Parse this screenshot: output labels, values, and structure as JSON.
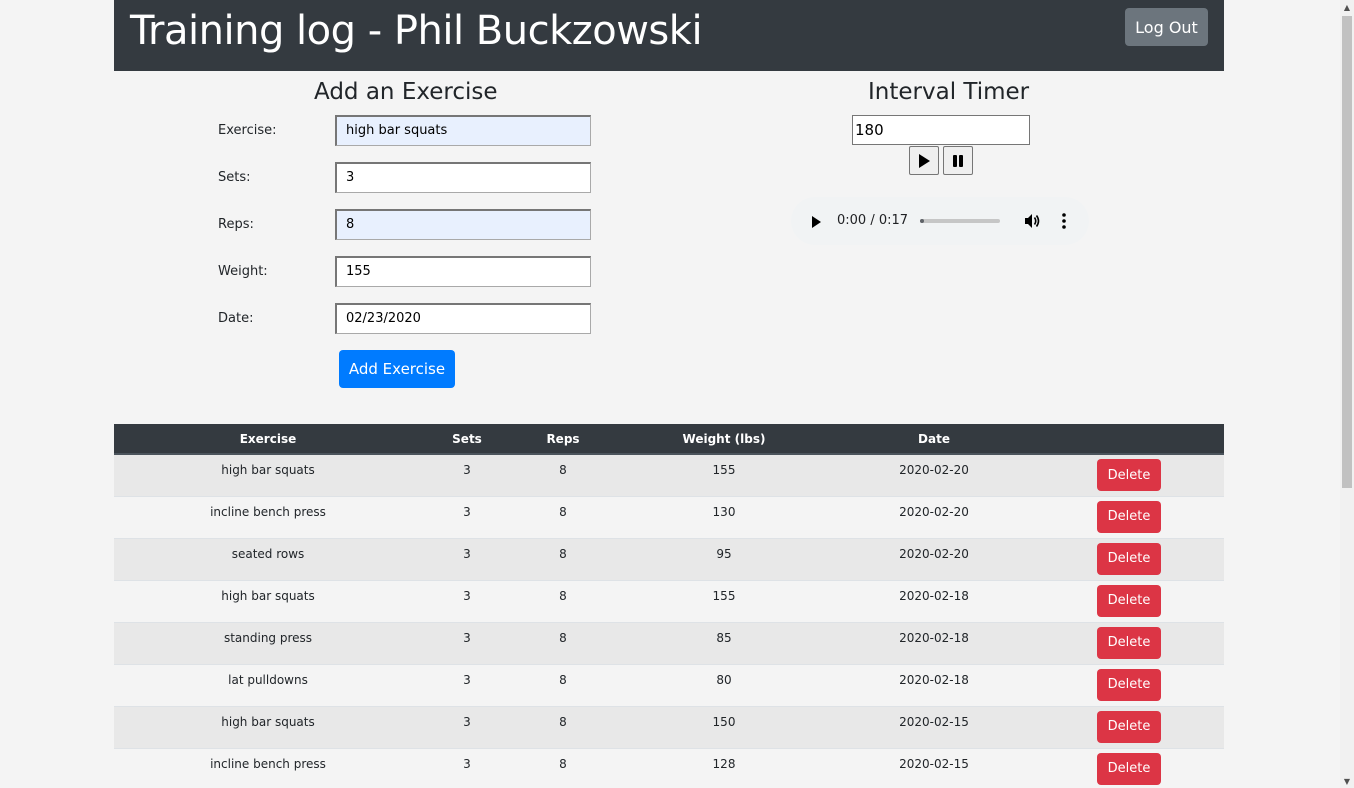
{
  "header": {
    "title": "Training log - Phil Buckzowski",
    "logout_label": "Log Out"
  },
  "add_exercise": {
    "title": "Add an Exercise",
    "fields": {
      "exercise": {
        "label": "Exercise:",
        "value": "high bar squats"
      },
      "sets": {
        "label": "Sets:",
        "value": "3"
      },
      "reps": {
        "label": "Reps:",
        "value": "8"
      },
      "weight": {
        "label": "Weight:",
        "value": "155"
      },
      "date": {
        "label": "Date:",
        "value": "02/23/2020"
      }
    },
    "submit_label": "Add Exercise"
  },
  "timer": {
    "title": "Interval Timer",
    "seconds": "180",
    "play_icon": "play-icon",
    "pause_icon": "pause-icon",
    "audio": {
      "time": "0:00 / 0:17",
      "progress": 0.05
    }
  },
  "table": {
    "headers": [
      "Exercise",
      "Sets",
      "Reps",
      "Weight (lbs)",
      "Date",
      ""
    ],
    "delete_label": "Delete",
    "rows": [
      {
        "exercise": "high bar squats",
        "sets": "3",
        "reps": "8",
        "weight": "155",
        "date": "2020-02-20"
      },
      {
        "exercise": "incline bench press",
        "sets": "3",
        "reps": "8",
        "weight": "130",
        "date": "2020-02-20"
      },
      {
        "exercise": "seated rows",
        "sets": "3",
        "reps": "8",
        "weight": "95",
        "date": "2020-02-20"
      },
      {
        "exercise": "high bar squats",
        "sets": "3",
        "reps": "8",
        "weight": "155",
        "date": "2020-02-18"
      },
      {
        "exercise": "standing press",
        "sets": "3",
        "reps": "8",
        "weight": "85",
        "date": "2020-02-18"
      },
      {
        "exercise": "lat pulldowns",
        "sets": "3",
        "reps": "8",
        "weight": "80",
        "date": "2020-02-18"
      },
      {
        "exercise": "high bar squats",
        "sets": "3",
        "reps": "8",
        "weight": "150",
        "date": "2020-02-15"
      },
      {
        "exercise": "incline bench press",
        "sets": "3",
        "reps": "8",
        "weight": "128",
        "date": "2020-02-15"
      }
    ]
  },
  "colors": {
    "header_bg": "#343a40",
    "primary": "#007bff",
    "danger": "#dc3545",
    "secondary": "#6c757d",
    "autofill": "#e8f0fe"
  }
}
